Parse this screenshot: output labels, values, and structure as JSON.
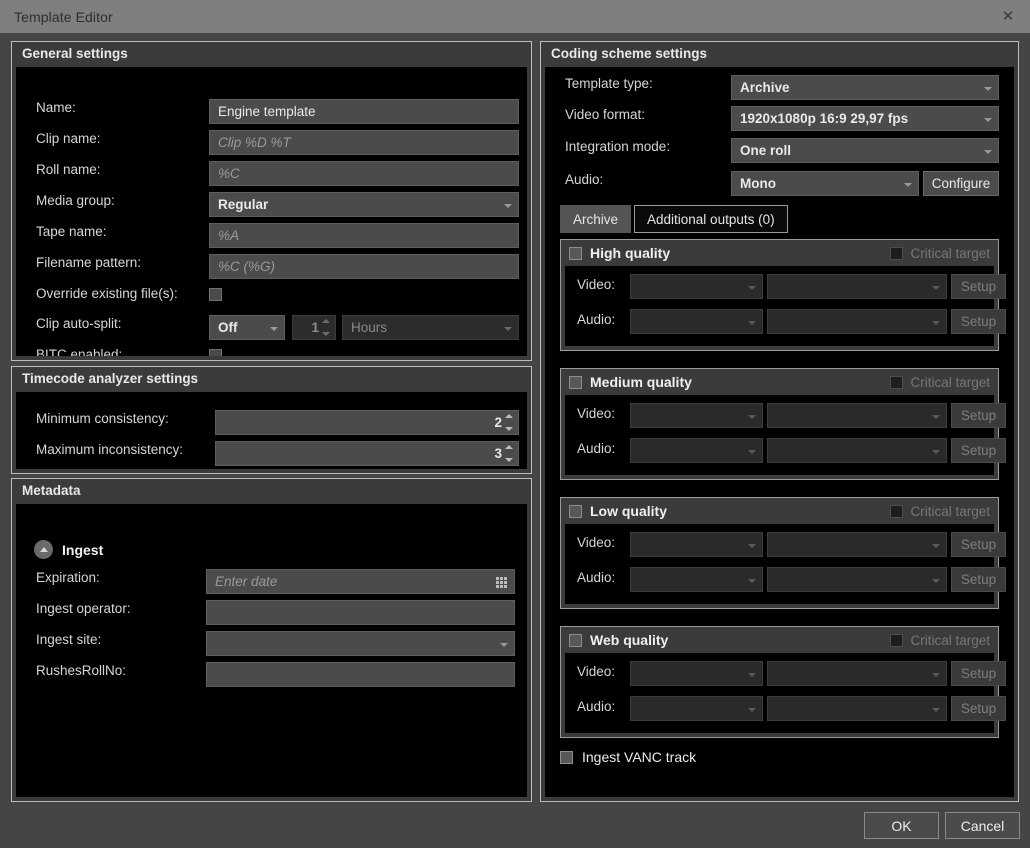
{
  "window": {
    "title": "Template Editor",
    "close_icon": "close-icon"
  },
  "general": {
    "title": "General settings",
    "rows": {
      "name_label": "Name:",
      "name_value": "Engine template",
      "clip_name_label": "Clip name:",
      "clip_name_placeholder": "Clip %D %T",
      "roll_name_label": "Roll name:",
      "roll_name_placeholder": "%C",
      "media_group_label": "Media group:",
      "media_group_value": "Regular",
      "tape_name_label": "Tape name:",
      "tape_name_placeholder": "%A",
      "filename_pattern_label": "Filename pattern:",
      "filename_pattern_placeholder": "%C (%G)",
      "override_label": "Override existing file(s):",
      "clip_autosplit_label": "Clip auto-split:",
      "clip_autosplit_value": "Off",
      "clip_autosplit_count": "1",
      "clip_autosplit_unit": "Hours",
      "bitc_label": "BITC enabled:"
    }
  },
  "timecode": {
    "title": "Timecode analyzer settings",
    "min_consistency_label": "Minimum consistency:",
    "min_consistency_value": "2",
    "max_inconsistency_label": "Maximum inconsistency:",
    "max_inconsistency_value": "3"
  },
  "metadata": {
    "title": "Metadata",
    "section_label": "Ingest",
    "expiration_label": "Expiration:",
    "expiration_placeholder": "Enter date",
    "operator_label": "Ingest operator:",
    "operator_value": "",
    "site_label": "Ingest site:",
    "site_value": "",
    "rushes_label": "RushesRollNo:",
    "rushes_value": ""
  },
  "coding": {
    "title": "Coding scheme settings",
    "template_type_label": "Template type:",
    "template_type_value": "Archive",
    "video_format_label": "Video format:",
    "video_format_value": "1920x1080p 16:9 29,97 fps",
    "integration_mode_label": "Integration mode:",
    "integration_mode_value": "One roll",
    "audio_label": "Audio:",
    "audio_value": "Mono",
    "configure_label": "Configure",
    "tabs": [
      {
        "label": "Archive",
        "active": true
      },
      {
        "label": "Additional outputs (0)",
        "active": false
      }
    ],
    "critical_target_label": "Critical target",
    "video_label": "Video:",
    "audio_row_label": "Audio:",
    "setup_label": "Setup",
    "qualities": [
      {
        "name": "High quality"
      },
      {
        "name": "Medium quality"
      },
      {
        "name": "Low quality"
      },
      {
        "name": "Web quality"
      }
    ],
    "vanc_label": "Ingest VANC track"
  },
  "footer": {
    "ok_label": "OK",
    "cancel_label": "Cancel"
  },
  "colors": {
    "titlebar": "#7f7f7f",
    "dialog_bg": "#454545",
    "panel_bg": "#3b3b3b",
    "content_bg": "#000000",
    "field_bg": "#4b4b4b",
    "border": "#bdbdbd",
    "text": "#d8d8d8",
    "disabled_text": "#7d7d7d"
  }
}
